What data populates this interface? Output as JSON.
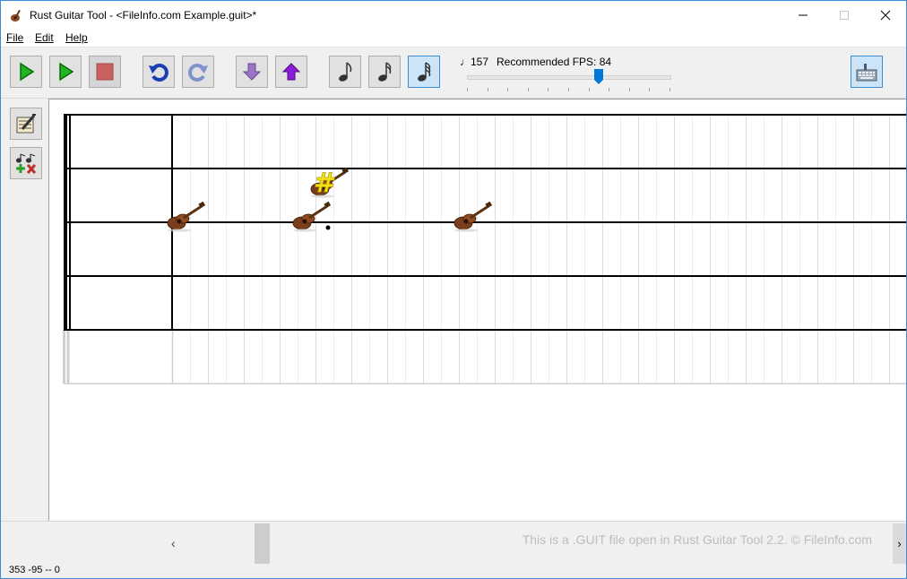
{
  "window": {
    "title": "Rust Guitar Tool - <FileInfo.com Example.guit>*",
    "minimize_glyph": "—",
    "maximize_glyph": "☐",
    "close_glyph": "✕"
  },
  "menu": {
    "file": "File",
    "edit": "Edit",
    "help": "Help"
  },
  "toolbar": {
    "buttons": [
      "play-from-start-icon",
      "play-icon",
      "stop-icon",
      "undo-icon",
      "redo-icon",
      "move-down-icon",
      "move-up-icon",
      "eighth-note-icon",
      "sixteenth-note-icon",
      "thirty-second-note-icon",
      "keyboard-icon"
    ],
    "active_note": "thirty-second-note-icon"
  },
  "tempo": {
    "glyph": "♩",
    "value": "157"
  },
  "fps": {
    "label": "Recommended FPS: 84",
    "slider_fraction": 0.65
  },
  "sidebar": {
    "buttons": [
      "edit-notes-icon",
      "add-remove-notes-icon"
    ]
  },
  "score": {
    "notes": [
      {
        "icon": "guitar-note-icon",
        "string": 2,
        "column": 1
      },
      {
        "icon": "guitar-note-icon",
        "string": 2,
        "column": 8,
        "dotted": true
      },
      {
        "icon": "guitar-note-icon",
        "string": 1,
        "column": 9,
        "sharp": true
      },
      {
        "icon": "guitar-note-icon",
        "string": 2,
        "column": 17
      }
    ]
  },
  "scrollbar": {
    "left_arrow": "‹",
    "right_arrow": "›"
  },
  "watermark": "This is a .GUIT file open in Rust Guitar Tool 2.2. © FileInfo.com",
  "status": "353 -95 -- 0",
  "colors": {
    "accent": "#3c8bd6",
    "play": "#22b422",
    "stop": "#c9625e",
    "undo": "#1a3db5",
    "move_down": "#9b74c8",
    "move_up": "#8a1bd6"
  }
}
